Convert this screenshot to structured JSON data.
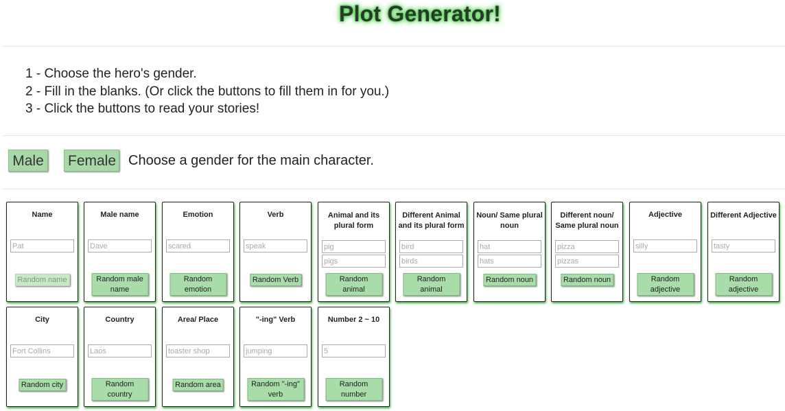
{
  "title": "Plot Generator!",
  "steps": [
    "1 - Choose the hero's gender.",
    "2 - Fill in the blanks. (Or click the buttons to fill them in for you.)",
    "3 - Click the buttons to read your stories!"
  ],
  "gender": {
    "male_label": "Male",
    "female_label": "Female",
    "hint": "Choose a gender for the main character."
  },
  "cards": [
    {
      "label": "Name",
      "placeholder": "Pat",
      "button": "Random name",
      "disabled": true
    },
    {
      "label": "Male name",
      "placeholder": "Dave",
      "button": "Random male name"
    },
    {
      "label": "Emotion",
      "placeholder": "scared",
      "button": "Random emotion"
    },
    {
      "label": "Verb",
      "placeholder": "speak",
      "button": "Random Verb"
    },
    {
      "label": "Animal and its plural form",
      "placeholder": "pig",
      "placeholder2": "pigs",
      "button": "Random animal"
    },
    {
      "label": "Different Animal and its plural form",
      "placeholder": "bird",
      "placeholder2": "birds",
      "button": "Random animal"
    },
    {
      "label": "Noun/ Same plural noun",
      "placeholder": "hat",
      "placeholder2": "hats",
      "button": "Random noun"
    },
    {
      "label": "Different noun/ Same plural noun",
      "placeholder": "pizza",
      "placeholder2": "pizzas",
      "button": "Random noun"
    },
    {
      "label": "Adjective",
      "placeholder": "silly",
      "button": "Random adjective"
    },
    {
      "label": "Different Adjective",
      "placeholder": "tasty",
      "button": "Random adjective"
    },
    {
      "label": "City",
      "placeholder": "Fort Collins",
      "button": "Random city"
    },
    {
      "label": "Country",
      "placeholder": "Laos",
      "button": "Random country"
    },
    {
      "label": "Area/ Place",
      "placeholder": "toaster shop",
      "button": "Random area"
    },
    {
      "label": "\"-ing\" Verb",
      "placeholder": "jumping",
      "button": "Random \"-ing\" verb"
    },
    {
      "label": "Number 2 ~ 10",
      "placeholder": "5",
      "button": "Random number"
    }
  ]
}
